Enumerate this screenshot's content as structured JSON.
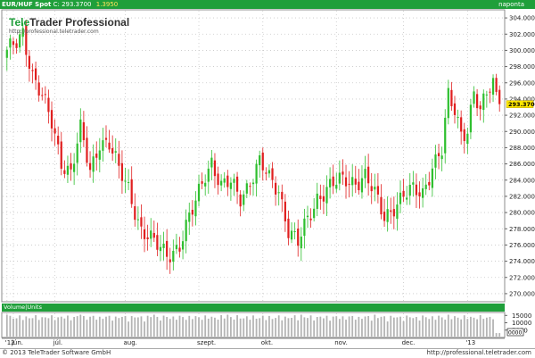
{
  "header": {
    "instrument": "EUR/HUF Spot",
    "close_label": "C: 293.3700",
    "change": "1.3950",
    "period": "naponta"
  },
  "logo": {
    "name_part1": "Tele",
    "name_part2": "Trader Professional",
    "url": "http://professional.teletrader.com"
  },
  "volume": {
    "title": "Volume|Units",
    "tick_labels": [
      "15000",
      "10000",
      "5000"
    ],
    "box_label": "0000"
  },
  "footer": {
    "copyright": "© 2013 TeleTrader Software GmbH",
    "url": "http://professional.teletrader.com"
  },
  "colors": {
    "header_bg": "#1f9f3a",
    "up": "#2fbf2f",
    "down": "#e02020",
    "last_price_box": "#ffe800",
    "volume_bar": "#b4b4b4"
  },
  "chart_data": {
    "type": "candlestick",
    "instrument": "EUR/HUF Spot",
    "interval": "daily",
    "last_price": "293.3700",
    "ylim": [
      269,
      305
    ],
    "yticks": [
      270,
      272,
      274,
      276,
      278,
      280,
      282,
      284,
      286,
      288,
      290,
      292,
      294,
      296,
      298,
      300,
      302,
      304
    ],
    "ytick_labels": [
      "270.0000",
      "272.0000",
      "274.0000",
      "276.0000",
      "278.0000",
      "280.0000",
      "282.0000",
      "284.0000",
      "286.0000",
      "288.0000",
      "290.0000",
      "292.0000",
      "294.0000",
      "296.0000",
      "298.0000",
      "300.0000",
      "302.0000",
      "304.0000"
    ],
    "xticks": [
      {
        "label": "'12",
        "x": 0
      },
      {
        "label": "jún.",
        "x": 2
      },
      {
        "label": "júl.",
        "x": 15
      },
      {
        "label": "aug.",
        "x": 37
      },
      {
        "label": "szept.",
        "x": 60
      },
      {
        "label": "okt.",
        "x": 80
      },
      {
        "label": "nov.",
        "x": 103
      },
      {
        "label": "dec.",
        "x": 124
      },
      {
        "label": "'13",
        "x": 144
      }
    ],
    "n_sessions": 155,
    "close_anchors": [
      [
        0,
        299.5
      ],
      [
        3,
        301
      ],
      [
        5,
        302.5
      ],
      [
        8,
        297
      ],
      [
        11,
        294
      ],
      [
        14,
        291
      ],
      [
        17,
        286.5
      ],
      [
        20,
        285
      ],
      [
        23,
        290
      ],
      [
        26,
        285
      ],
      [
        29,
        289
      ],
      [
        32,
        288.5
      ],
      [
        35,
        285
      ],
      [
        38,
        283
      ],
      [
        42,
        278
      ],
      [
        46,
        276
      ],
      [
        50,
        275
      ],
      [
        54,
        276
      ],
      [
        58,
        280
      ],
      [
        62,
        285
      ],
      [
        64,
        286.5
      ],
      [
        67,
        283
      ],
      [
        70,
        283.5
      ],
      [
        73,
        282
      ],
      [
        76,
        284
      ],
      [
        79,
        286
      ],
      [
        82,
        284
      ],
      [
        85,
        283
      ],
      [
        88,
        278
      ],
      [
        91,
        276
      ],
      [
        94,
        279
      ],
      [
        97,
        282
      ],
      [
        100,
        283
      ],
      [
        103,
        283.5
      ],
      [
        106,
        284
      ],
      [
        109,
        284
      ],
      [
        112,
        284.5
      ],
      [
        115,
        282
      ],
      [
        118,
        279.5
      ],
      [
        121,
        281
      ],
      [
        124,
        282
      ],
      [
        127,
        282.5
      ],
      [
        130,
        282.5
      ],
      [
        133,
        286
      ],
      [
        136,
        287.5
      ],
      [
        138,
        294
      ],
      [
        140,
        292.5
      ],
      [
        142,
        290
      ],
      [
        144,
        290.5
      ],
      [
        146,
        295
      ],
      [
        148,
        292
      ],
      [
        150,
        294.5
      ],
      [
        152,
        296
      ],
      [
        154,
        293.37
      ]
    ],
    "volume_level_approx": [
      10000,
      15000
    ]
  }
}
